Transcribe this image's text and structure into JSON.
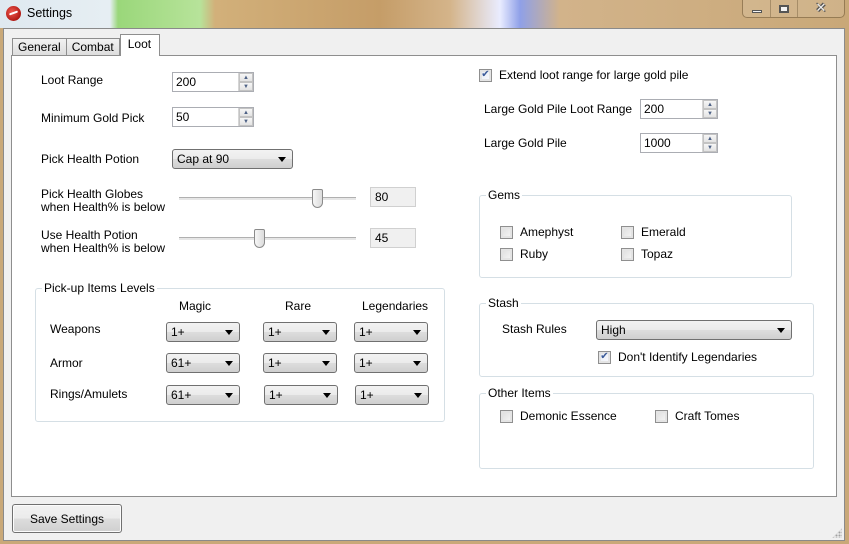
{
  "window": {
    "title": "Settings",
    "controls": {
      "minimize": "minimize",
      "maximize": "maximize",
      "close": "close"
    }
  },
  "tabs": [
    {
      "label": "General",
      "active": false
    },
    {
      "label": "Combat",
      "active": false
    },
    {
      "label": "Loot",
      "active": true
    }
  ],
  "loot": {
    "loot_range": {
      "label": "Loot Range",
      "value": "200"
    },
    "min_gold_pick": {
      "label": "Minimum Gold Pick",
      "value": "50"
    },
    "pick_health_potion": {
      "label": "Pick Health Potion",
      "selected": "Cap at 90"
    },
    "pick_health_globes": {
      "label_line1": "Pick Health Globes",
      "label_line2": "when Health% is below",
      "value": "80",
      "slider_percent": 80
    },
    "use_health_potion": {
      "label_line1": "Use Health Potion",
      "label_line2": "when Health% is below",
      "value": "45",
      "slider_percent": 45
    },
    "item_levels": {
      "title": "Pick-up Items Levels",
      "columns": [
        "Magic",
        "Rare",
        "Legendaries"
      ],
      "rows": [
        {
          "label": "Weapons",
          "values": [
            "1+",
            "1+",
            "1+"
          ]
        },
        {
          "label": "Armor",
          "values": [
            "61+",
            "1+",
            "1+"
          ]
        },
        {
          "label": "Rings/Amulets",
          "values": [
            "61+",
            "1+",
            "1+"
          ]
        }
      ]
    },
    "extend_loot_range": {
      "label": "Extend loot range for large gold pile",
      "checked": true
    },
    "large_gold_pile_loot_range": {
      "label": "Large Gold Pile Loot Range",
      "value": "200"
    },
    "large_gold_pile": {
      "label": "Large Gold Pile",
      "value": "1000"
    },
    "gems": {
      "title": "Gems",
      "items": [
        {
          "label": "Amephyst",
          "checked": false
        },
        {
          "label": "Emerald",
          "checked": false
        },
        {
          "label": "Ruby",
          "checked": false
        },
        {
          "label": "Topaz",
          "checked": false
        }
      ]
    },
    "stash": {
      "title": "Stash",
      "rules_label": "Stash Rules",
      "rules_selected": "High",
      "dont_identify": {
        "label": "Don't Identify Legendaries",
        "checked": true
      }
    },
    "other_items": {
      "title": "Other Items",
      "items": [
        {
          "label": "Demonic Essence",
          "checked": false
        },
        {
          "label": "Craft Tomes",
          "checked": false
        }
      ]
    }
  },
  "footer": {
    "save_label": "Save Settings"
  },
  "icons": {
    "check_glyph": "✔"
  }
}
